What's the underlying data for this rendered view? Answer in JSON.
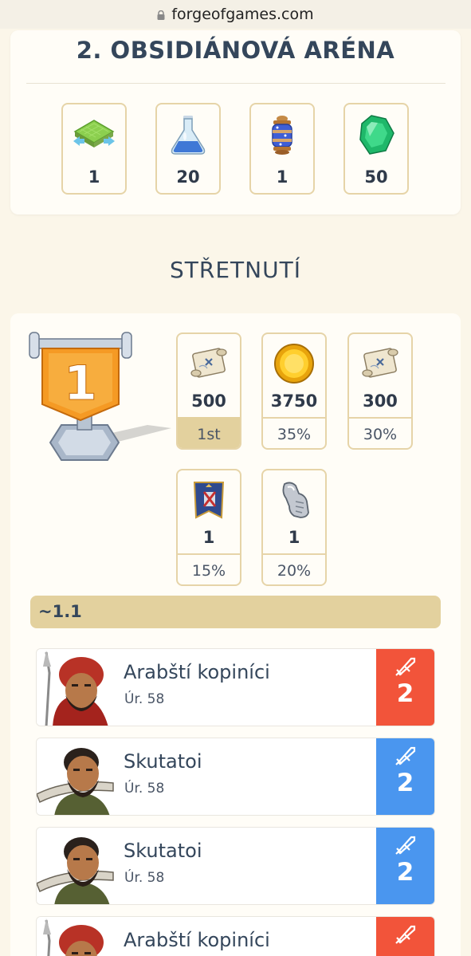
{
  "browser": {
    "url": "forgeofgames.com"
  },
  "arena": {
    "title": "2. OBSIDIÁNOVÁ ARÉNA",
    "rewards": [
      {
        "icon": "expansion-icon",
        "value": "1"
      },
      {
        "icon": "flask-icon",
        "value": "20"
      },
      {
        "icon": "lantern-icon",
        "value": "1"
      },
      {
        "icon": "emerald-gem-icon",
        "value": "50"
      }
    ]
  },
  "encounter": {
    "title": "STŘETNUTÍ",
    "trophy_rank": "1",
    "rewards": [
      {
        "icon": "scroll-icon",
        "value": "500",
        "sub": "1st",
        "highlight": true
      },
      {
        "icon": "coin-icon",
        "value": "3750",
        "sub": "35%"
      },
      {
        "icon": "scroll-icon",
        "value": "300",
        "sub": "30%"
      },
      {
        "icon": "banner-icon",
        "value": "1",
        "sub": "15%"
      },
      {
        "icon": "gauntlet-icon",
        "value": "1",
        "sub": "20%"
      }
    ],
    "difficulty": "~1.1",
    "units": [
      {
        "name": "Arabští kopiníci",
        "level": "Úr. 58",
        "count": "2",
        "color": "#f2543a"
      },
      {
        "name": "Skutatoi",
        "level": "Úr. 58",
        "count": "2",
        "color": "#4a96ef"
      },
      {
        "name": "Skutatoi",
        "level": "Úr. 58",
        "count": "2",
        "color": "#4a96ef"
      },
      {
        "name": "Arabští kopiníci",
        "level": "",
        "count": "",
        "color": "#f2543a"
      }
    ]
  }
}
